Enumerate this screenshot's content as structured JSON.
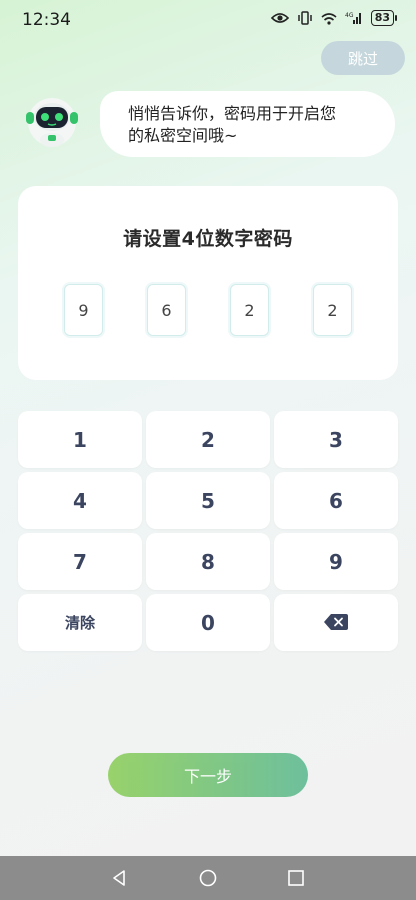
{
  "status_bar": {
    "time": "12:34",
    "battery": "83",
    "network": "4G"
  },
  "header": {
    "skip_label": "跳过"
  },
  "bubble": {
    "line1": "悄悄告诉你，密码用于开启您",
    "line2": "的私密空间哦~"
  },
  "card": {
    "title": "请设置4位数字密码",
    "digits": [
      "9",
      "6",
      "2",
      "2"
    ]
  },
  "keypad": {
    "keys": [
      "1",
      "2",
      "3",
      "4",
      "5",
      "6",
      "7",
      "8",
      "9"
    ],
    "clear_label": "清除",
    "zero_label": "0",
    "backspace_icon": "backspace-icon"
  },
  "footer": {
    "next_label": "下一步"
  },
  "colors": {
    "accent_start": "#90cf5f",
    "accent_end": "#62bb95",
    "key_text": "#3b4560",
    "skip_bg": "#c5d7dc"
  }
}
